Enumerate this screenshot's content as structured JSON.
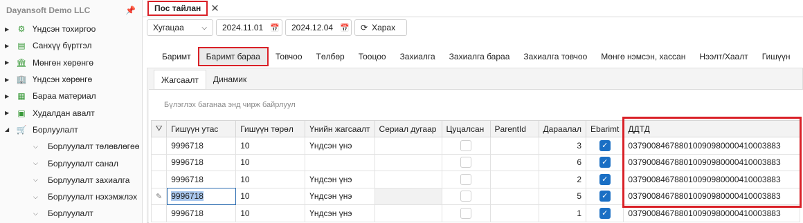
{
  "sidebar": {
    "title": "Dayansoft Demo LLC",
    "items": [
      {
        "label": "Үндсэн тохиргоо",
        "icon": "gear-icon",
        "glyph": "⚙"
      },
      {
        "label": "Санхүү бүртгэл",
        "icon": "ledger-icon",
        "glyph": "▤"
      },
      {
        "label": "Мөнгөн хөрөнгө",
        "icon": "bank-icon",
        "glyph": "🏛"
      },
      {
        "label": "Үндсэн хөрөнгө",
        "icon": "building-icon",
        "glyph": "🏢"
      },
      {
        "label": "Бараа материал",
        "icon": "inventory-icon",
        "glyph": "▦"
      },
      {
        "label": "Худалдан авалт",
        "icon": "purchase-icon",
        "glyph": "▣"
      },
      {
        "label": "Борлуулалт",
        "icon": "cart-icon",
        "glyph": "🛒"
      }
    ],
    "subitems": [
      "Борлуулалт төлөвлөгөө",
      "Борлуулалт санал",
      "Борлуулалт захиалга",
      "Борлуулалт нэхэмжлэх",
      "Борлуулалт"
    ]
  },
  "doc_tab": {
    "label": "Пос тайлан"
  },
  "toolbar": {
    "period": "Хугацаа",
    "date_from": "2024.11.01",
    "date_to": "2024.12.04",
    "back": "Харах"
  },
  "section_tabs": [
    "Баримт",
    "Баримт бараа",
    "Товчоо",
    "Төлбөр",
    "Тооцоо",
    "Захиалга",
    "Захиалга бараа",
    "Захиалга товчоо",
    "Мөнгө нэмсэн, хассан",
    "Нээлт/Хаалт",
    "Гишүүн"
  ],
  "inner_tabs": [
    "Жагсаалт",
    "Динамик"
  ],
  "grid": {
    "group_hint": "Бүлэглэх баганаа энд чирж байрлуул",
    "columns": [
      "Гишүүн утас",
      "Гишүүн төрөл",
      "Үнийн жагсаалт",
      "Сериал дугаар",
      "Цуцалсан",
      "ParentId",
      "Дараалал",
      "Ebarimt",
      "ДДТД"
    ],
    "rows": [
      {
        "phone": "9996718",
        "type": "10",
        "price": "Үндсэн үнэ",
        "seq": "3",
        "ddtd": "037900846788010090980000410003883"
      },
      {
        "phone": "9996718",
        "type": "10",
        "price": "",
        "seq": "6",
        "ddtd": "037900846788010090980000410003883"
      },
      {
        "phone": "9996718",
        "type": "10",
        "price": "Үндсэн үнэ",
        "seq": "2",
        "ddtd": "037900846788010090980000410003883"
      },
      {
        "phone": "9996718",
        "type": "10",
        "price": "Үндсэн үнэ",
        "seq": "5",
        "ddtd": "037900846788010090980000410003883"
      },
      {
        "phone": "9996718",
        "type": "10",
        "price": "Үндсэн үнэ",
        "seq": "1",
        "ddtd": "037900846788010090980000410003883"
      }
    ]
  },
  "colors": {
    "accent": "#d92027",
    "checkbox": "#1a6fc4",
    "icon": "#3a9a3a"
  }
}
